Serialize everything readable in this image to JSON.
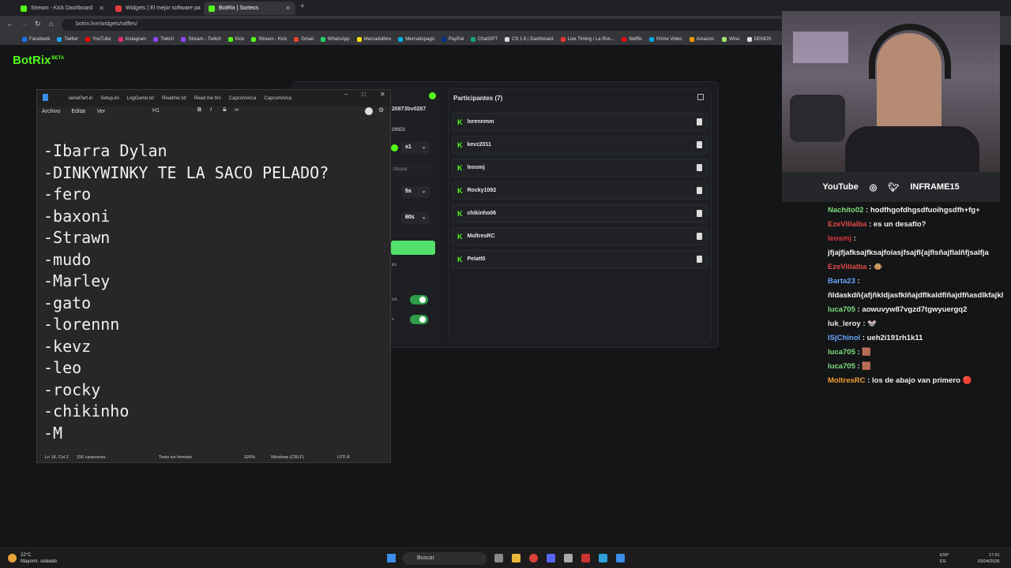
{
  "browser": {
    "tabs": [
      {
        "label": "Stream - Kick Dashboard",
        "color": "#53fc18"
      },
      {
        "label": "Widgets | El mejor software pa",
        "color": "#e33b3b"
      },
      {
        "label": "BotRix | Sorteos",
        "color": "#53fc18"
      }
    ],
    "url": "botrix.live/widgets/raffles/",
    "bookmarks": [
      "Facebook",
      "Twitter",
      "YouTube",
      "Instagram",
      "Twitch",
      "Stream - Twitch",
      "Kick",
      "Stream - Kick",
      "Gmail",
      "WhatsApp",
      "Mercadolibre",
      "Mercadopago",
      "PayPal",
      "ChatGPT",
      "CS 1.6 | Dashboard",
      "Live Timing / La Ron...",
      "Netflix",
      "Prime Video",
      "Amazon.",
      "Wise",
      "DEMOS"
    ]
  },
  "app": {
    "logo": "BotRix",
    "logo_badge": "BETA",
    "accent": "#53fc18"
  },
  "raffle": {
    "id_fragment": "20873bv0287",
    "section_fragment": "ORES",
    "multiplier": "x1",
    "participate_fragment": "rticipar",
    "timer1": "5s",
    "timer2": "60s",
    "es_fragment": "es",
    "toggle1_fragment": "tch",
    "toggle2_fragment": "s"
  },
  "participants": {
    "title": "Participantes (7)",
    "items": [
      "lorennmm",
      "kevz2011",
      "leosmj",
      "Rocky1092",
      "chikinho06",
      "MoltresRC",
      "Pelatt0"
    ]
  },
  "notepad": {
    "tabs": [
      "iamePart.in",
      "Setup.ini",
      "LogGame.txt",
      "Readme.txt",
      "Read me firs",
      "CapcomArca",
      "CapcomArca"
    ],
    "menu": [
      "Archivo",
      "Editar",
      "Ver"
    ],
    "heading_select": "H1",
    "lines": [
      "-Ibarra Dylan",
      "-DINKYWINKY TE LA SACO PELADO?",
      "-fero",
      "-baxoni",
      "-Strawn",
      "-mudo",
      "-Marley",
      "-gato",
      "-lorennn",
      "-kevz",
      "-leo",
      "-rocky",
      "-chikinho",
      "-M"
    ],
    "status": {
      "pos": "Ln 16, Col 2",
      "chars": "156 caracteres.",
      "format": "Texto sin formato",
      "zoom": "320%",
      "eol": "Windows (CRLF)",
      "enc": "UTF-8"
    }
  },
  "webcam": {
    "youtube": "YouTube",
    "handle": "INFRAME15"
  },
  "chat": [
    {
      "user": "Nachito02",
      "color": "#7ee07e",
      "text": "hodfhgofdhgsdfuoihgsdfh+fg+"
    },
    {
      "user": "EzeVillalba",
      "color": "#e34a4a",
      "text": "es un desafío?"
    },
    {
      "user": "leosmj",
      "color": "#d9363e",
      "text": "jfjajfjafksajfksajfoiasjfsajfl{ajflsñajflalñfjsalfja"
    },
    {
      "user": "EzeVillalba",
      "color": "#e34a4a",
      "text": "🐵"
    },
    {
      "user": "Barta23",
      "color": "#6aa6ff",
      "text": "ñldaskdñ{afjñkldjasfklñajdflkaldflñajdfñasdlkfajkl"
    },
    {
      "user": "luca705",
      "color": "#7ee07e",
      "text": "aowuvyw87vgzd7tgwyuergq2"
    },
    {
      "user": "luk_leroy",
      "color": "#e8e8e8",
      "text": "🐭"
    },
    {
      "user": "ISjChinol",
      "color": "#6aa6ff",
      "text": "ueh2i191rh1k11"
    },
    {
      "user": "luca705",
      "color": "#7ee07e",
      "text": "🟫"
    },
    {
      "user": "luca705",
      "color": "#7ee07e",
      "text": "🟫"
    },
    {
      "user": "MoltresRC",
      "color": "#f0a030",
      "text": "los de abajo van primero 🔴"
    }
  ],
  "taskbar": {
    "temp": "22°C",
    "weather": "Mayorm. soleado",
    "search": "Buscar",
    "lang": "ESP",
    "lang2": "ES",
    "time": "17:31",
    "date": "03/04/2026"
  }
}
